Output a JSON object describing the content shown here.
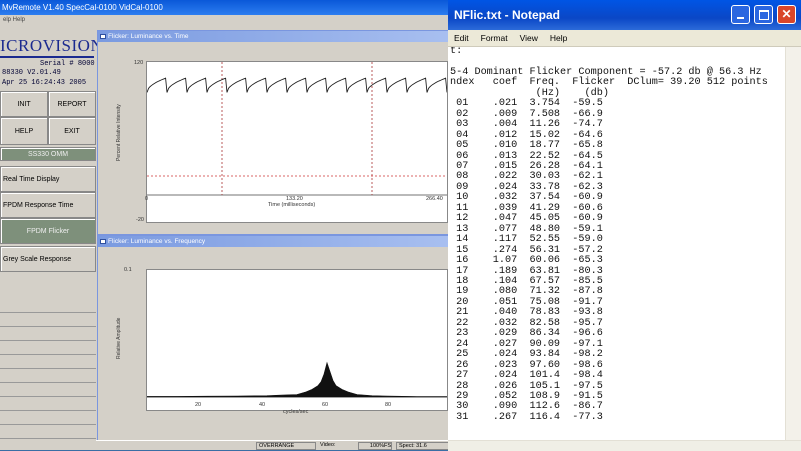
{
  "app": {
    "title": "MvRemote V1.40   SpecCal-0100 VidCal-0100",
    "menu": "elp  Help",
    "brand": "ICROVISION",
    "serial_label": "Serial #",
    "serial_number": "8000",
    "version": "88330 V2.01.49",
    "datetime": "Apr 25 16:24:43 2005",
    "buttons": {
      "init": "INIT",
      "report": "REPORT",
      "help": "HELP",
      "exit": "EXIT"
    },
    "model": "SS330 OMM",
    "modes": [
      "Real Time Display",
      "FPDM Response Time",
      "FPDM Flicker",
      "Grey Scale Response"
    ],
    "status": {
      "overrange": "OVERRANGE",
      "video_label": "Video:",
      "percent_fs": "100%FS",
      "spect": "Spect: 31.6"
    }
  },
  "chart_data": [
    {
      "type": "line",
      "title": "Flicker: Luminance vs. Time",
      "xlabel": "Time (milliseconds)",
      "ylabel": "Percent Relative Intensity",
      "xlim": [
        0,
        266.4
      ],
      "ylim": [
        -20,
        120
      ],
      "x_ticks": [
        "0",
        "133.20",
        "266.40"
      ],
      "y_ticks": [
        "120",
        "-20"
      ],
      "x": [
        0,
        17.8,
        35.5,
        53.3,
        71,
        88.8,
        106.6,
        124.3,
        142.1,
        159.8,
        177.6,
        195.4,
        213.1,
        230.9,
        248.6,
        266.4
      ],
      "series": [
        {
          "name": "",
          "values": [
            100,
            100,
            100,
            100,
            100,
            100,
            100,
            100,
            100,
            100,
            100,
            100,
            100,
            100,
            100,
            100
          ]
        }
      ],
      "waveform": "sawtooth",
      "cycles": 15,
      "amplitude_low": 88,
      "amplitude_high": 103,
      "cursors_x": [
        66.6,
        199.8
      ],
      "reference_y": 0
    },
    {
      "type": "area",
      "title": "Flicker: Luminance vs. Frequency",
      "xlabel": "cycles/sec",
      "ylabel": "Relative Amplitude",
      "xlim": [
        0,
        100
      ],
      "ylim": [
        0,
        0.1
      ],
      "x_ticks": [
        "20",
        "40",
        "60",
        "80"
      ],
      "y_ticks": [
        "0.1"
      ],
      "x": [
        0,
        10,
        20,
        30,
        40,
        45,
        50,
        53,
        55,
        57,
        58,
        59,
        60,
        61,
        62,
        63,
        65,
        67,
        70,
        75,
        80,
        90,
        100
      ],
      "series": [
        {
          "name": "",
          "values": [
            0.0005,
            0.0005,
            0.0006,
            0.0008,
            0.001,
            0.0015,
            0.002,
            0.004,
            0.006,
            0.009,
            0.012,
            0.018,
            0.027,
            0.02,
            0.013,
            0.009,
            0.006,
            0.004,
            0.002,
            0.001,
            0.0007,
            0.0004,
            0.0003
          ]
        }
      ]
    }
  ],
  "notepad": {
    "title": "NFlic.txt - Notepad",
    "menu": [
      "Edit",
      "Format",
      "View",
      "Help"
    ],
    "lines": [
      "t:",
      "",
      "5-4 Dominant Flicker Component = -57.2 db @ 56.3 Hz",
      "ndex   coef  Freq.  Flicker  DClum= 39.20 512 points",
      "              (Hz)    (db)",
      " 01    .021  3.754  -59.5",
      " 02    .009  7.508  -66.9",
      " 03    .004  11.26  -74.7",
      " 04    .012  15.02  -64.6",
      " 05    .010  18.77  -65.8",
      " 06    .013  22.52  -64.5",
      " 07    .015  26.28  -64.1",
      " 08    .022  30.03  -62.1",
      " 09    .024  33.78  -62.3",
      " 10    .032  37.54  -60.9",
      " 11    .039  41.29  -60.6",
      " 12    .047  45.05  -60.9",
      " 13    .077  48.80  -59.1",
      " 14    .117  52.55  -59.0",
      " 15    .274  56.31  -57.2",
      " 16    1.07  60.06  -65.3",
      " 17    .189  63.81  -80.3",
      " 18    .104  67.57  -85.5",
      " 19    .080  71.32  -87.8",
      " 20    .051  75.08  -91.7",
      " 21    .040  78.83  -93.8",
      " 22    .032  82.58  -95.7",
      " 23    .029  86.34  -96.6",
      " 24    .027  90.09  -97.1",
      " 25    .024  93.84  -98.2",
      " 26    .023  97.60  -98.6",
      " 27    .024  101.4  -98.4",
      " 28    .026  105.1  -97.5",
      " 29    .052  108.9  -91.5",
      " 30    .090  112.6  -86.7",
      " 31    .267  116.4  -77.3"
    ]
  }
}
